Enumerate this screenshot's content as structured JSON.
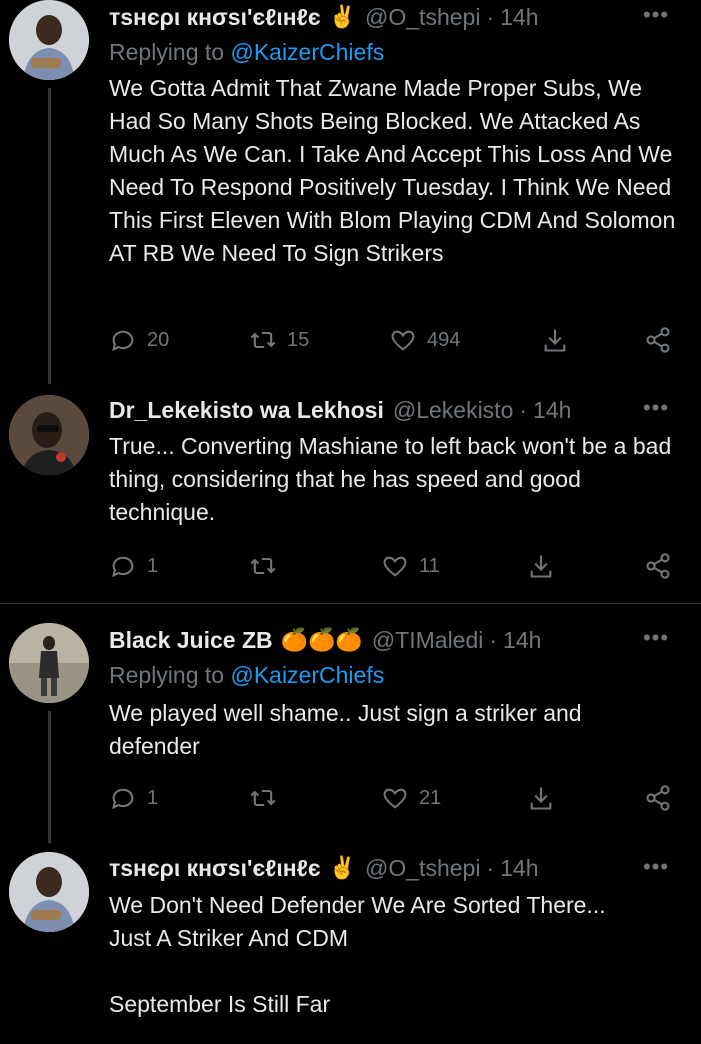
{
  "tweets": [
    {
      "name": "ᴛѕнєρι кнσѕι'єℓιнℓє",
      "emoji": "✌️",
      "handle": "@O_tshepi",
      "time": "14h",
      "replying_label": "Replying to",
      "replying_handle": "@KaizerChiefs",
      "body": "We Gotta Admit That Zwane Made Proper Subs, We Had So Many Shots Being Blocked. We Attacked As Much As We Can. I Take And Accept This Loss And We Need To Respond Positively Tuesday. I Think We Need This First Eleven With Blom Playing CDM And Solomon AT RB We Need To Sign Strikers",
      "replies": "20",
      "retweets": "15",
      "likes": "494"
    },
    {
      "name": "Dr_Lekekisto wa Lekhosi",
      "emoji": "",
      "handle": "@Lekekisto",
      "time": "14h",
      "body": "True... Converting Mashiane to left back won't be a bad thing, considering that he has speed and good technique.",
      "replies": "1",
      "retweets": "",
      "likes": "11"
    },
    {
      "name": "Black Juice ZB",
      "emoji": "🍊🍊🍊",
      "handle": "@TIMaledi",
      "time": "14h",
      "replying_label": "Replying to",
      "replying_handle": "@KaizerChiefs",
      "body": "We played well shame.. Just sign a striker and defender",
      "replies": "1",
      "retweets": "",
      "likes": "21"
    },
    {
      "name": "ᴛѕнєρι кнσѕι'єℓιнℓє",
      "emoji": "✌️",
      "handle": "@O_tshepi",
      "time": "14h",
      "body": "We Don't Need Defender We Are Sorted There...\nJust A Striker And CDM\n\nSeptember Is Still Far"
    }
  ],
  "dot": "·",
  "more": "•••"
}
